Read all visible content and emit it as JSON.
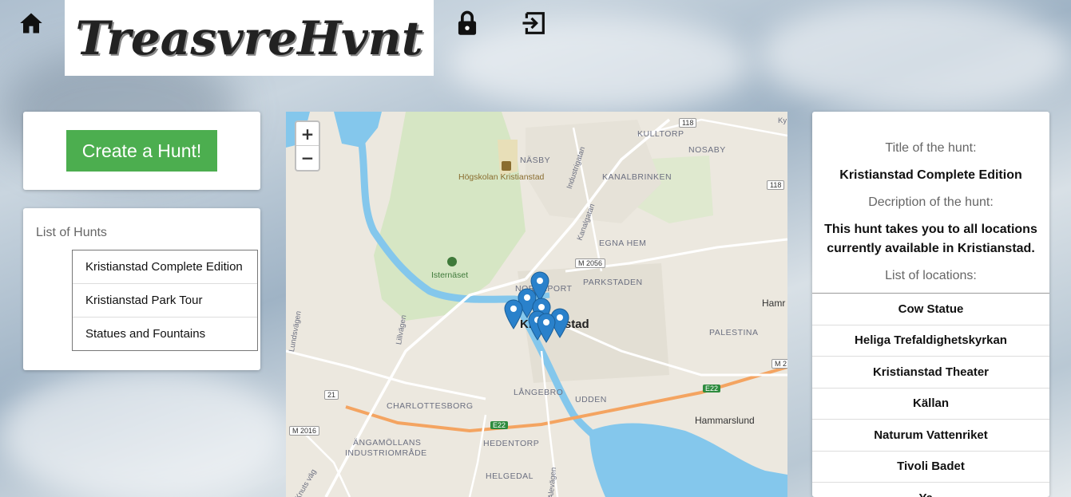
{
  "nav": {
    "home_icon": "home-icon",
    "logo_text": "TreasvreHvnt",
    "lock_icon": "lock-icon",
    "logout_icon": "exit-icon"
  },
  "create": {
    "label": "Create a Hunt!"
  },
  "hunts": {
    "title": "List of Hunts",
    "items": [
      "Kristianstad Complete Edition",
      "Kristianstad Park Tour",
      "Statues and Fountains"
    ]
  },
  "map": {
    "zoom_in": "+",
    "zoom_out": "−",
    "labels": {
      "kulltorp": "KULLTORP",
      "nasby": "NÄSBY",
      "nosaby": "NOSABY",
      "hogskolan": "Högskolan Kristianstad",
      "kanalbrinken": "KANALBRINKEN",
      "industrigatan": "Industrigatan",
      "kanalgatan": "Kanalgatan",
      "egnahem": "EGNA HEM",
      "isternaset": "Isternäset",
      "norreport": "NORREPORT",
      "parkstaden": "PARKSTADEN",
      "hamr": "Hamr",
      "lillvagen": "Lillvägen",
      "lundsvagen": "Lundsvägen",
      "city": "Kristianstad",
      "palestina": "PALESTINA",
      "langebro": "LÅNGEBRO",
      "udden": "UDDEN",
      "charlottesborg": "CHARLOTTESBORG",
      "hammarslund": "Hammarslund",
      "angamollans1": "ÄNGAMÖLLANS",
      "angamollans2": "INDUSTRIOMRÅDE",
      "hedentorp": "HEDENTORP",
      "helgedal": "HELGEDAL",
      "knuts": "Knuts väg",
      "alevagen": "Alevägen",
      "ky": "Ky"
    },
    "badges": {
      "r118a": "118",
      "r118b": "118",
      "m2056": "M 2056",
      "r21": "21",
      "e22a": "E22",
      "e22b": "E22",
      "m2016": "M 2016",
      "m2": "M 2"
    },
    "markers": 7
  },
  "detail": {
    "title_label": "Title of the hunt:",
    "title_value": "Kristianstad Complete Edition",
    "desc_label": "Decription of the hunt:",
    "desc_value": "This hunt takes you to all locations currently available in Kristianstad.",
    "locations_label": "List of locations:",
    "locations": [
      "Cow Statue",
      "Heliga Trefaldighetskyrkan",
      "Kristianstad Theater",
      "Källan",
      "Naturum Vattenriket",
      "Tivoli Badet",
      "Ya..."
    ]
  },
  "colors": {
    "accent_green": "#4cae4f",
    "marker_blue": "#2a81cb",
    "water": "#84c7ec"
  }
}
